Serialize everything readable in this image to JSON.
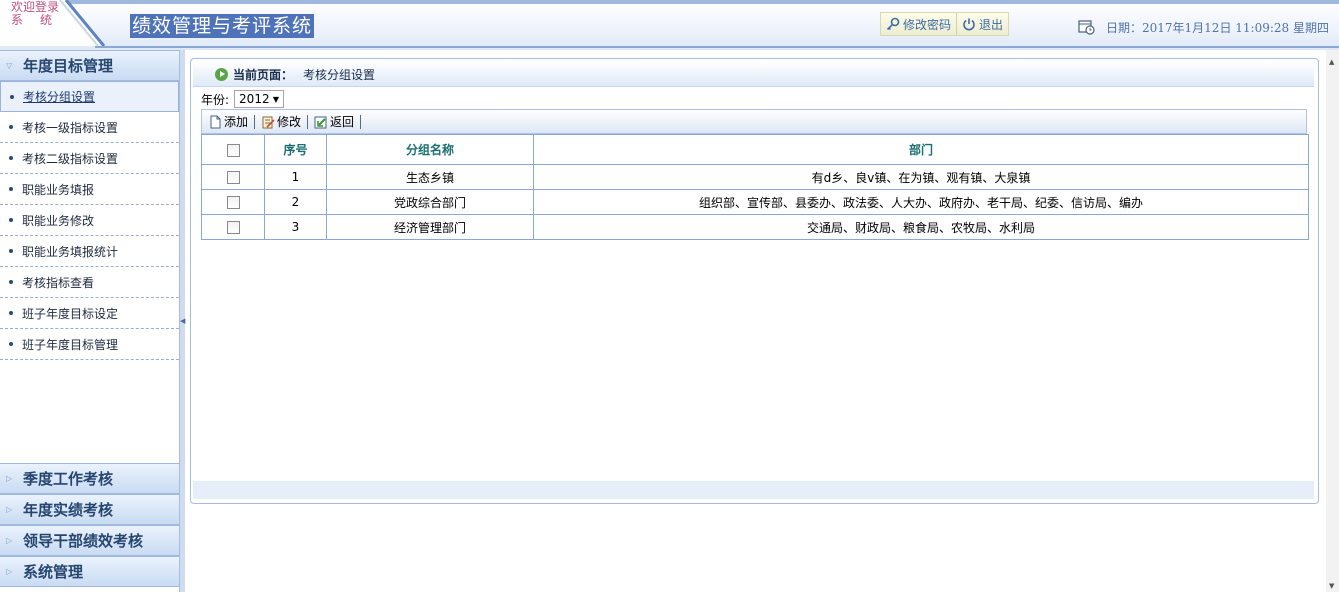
{
  "header": {
    "welcome_line1": "欢迎登录",
    "welcome_line2": "系统",
    "title": "绩效管理与考评系统",
    "change_password_label": "修改密码",
    "logout_label": "退出",
    "date_text": "日期：2017年1月12日  11:09:28 星期四"
  },
  "sidebar": {
    "open_section": "年度目标管理",
    "items": [
      {
        "label": "考核分组设置"
      },
      {
        "label": "考核一级指标设置"
      },
      {
        "label": "考核二级指标设置"
      },
      {
        "label": "职能业务填报"
      },
      {
        "label": "职能业务修改"
      },
      {
        "label": "职能业务填报统计"
      },
      {
        "label": "考核指标查看"
      },
      {
        "label": "班子年度目标设定"
      },
      {
        "label": "班子年度目标管理"
      }
    ],
    "collapsed_sections": [
      {
        "label": "季度工作考核"
      },
      {
        "label": "年度实绩考核"
      },
      {
        "label": "领导干部绩效考核"
      },
      {
        "label": "系统管理"
      }
    ]
  },
  "breadcrumb": {
    "label": "当前页面：",
    "value": "考核分组设置"
  },
  "filter": {
    "year_label": "年份:",
    "year_value": "2012"
  },
  "toolbar": {
    "add_label": "添加",
    "edit_label": "修改",
    "back_label": "返回"
  },
  "table": {
    "headers": [
      "序号",
      "分组名称",
      "部门"
    ],
    "rows": [
      {
        "no": "1",
        "name": "生态乡镇",
        "depts": "有d乡、良v镇、在为镇、观有镇、大泉镇"
      },
      {
        "no": "2",
        "name": "党政综合部门",
        "depts": "组织部、宣传部、县委办、政法委、人大办、政府办、老干局、纪委、信访局、编办"
      },
      {
        "no": "3",
        "name": "经济管理部门",
        "depts": "交通局、财政局、粮食局、农牧局、水利局"
      }
    ]
  }
}
